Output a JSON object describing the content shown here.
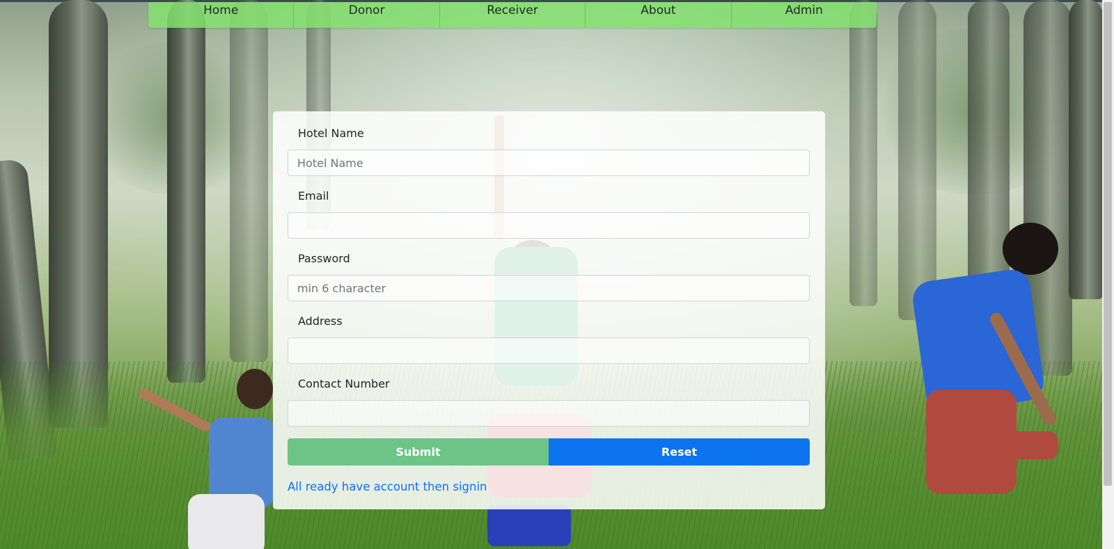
{
  "nav": {
    "items": [
      {
        "label": "Home"
      },
      {
        "label": "Donor"
      },
      {
        "label": "Receiver"
      },
      {
        "label": "About"
      },
      {
        "label": "Admin"
      }
    ]
  },
  "form": {
    "hotel_name": {
      "label": "Hotel Name",
      "placeholder": "Hotel Name",
      "value": ""
    },
    "email": {
      "label": "Email",
      "placeholder": "",
      "value": ""
    },
    "password": {
      "label": "Password",
      "placeholder": "min 6 character",
      "value": ""
    },
    "address": {
      "label": "Address",
      "placeholder": "",
      "value": ""
    },
    "contact_number": {
      "label": "Contact Number",
      "placeholder": "",
      "value": ""
    },
    "submit_label": "Submit",
    "reset_label": "Reset",
    "signin_link": "All ready have account then signin"
  },
  "colors": {
    "nav_bg": "#82e26e",
    "submit": "#6cc486",
    "reset": "#0d74f0",
    "link": "#0d6efd"
  }
}
